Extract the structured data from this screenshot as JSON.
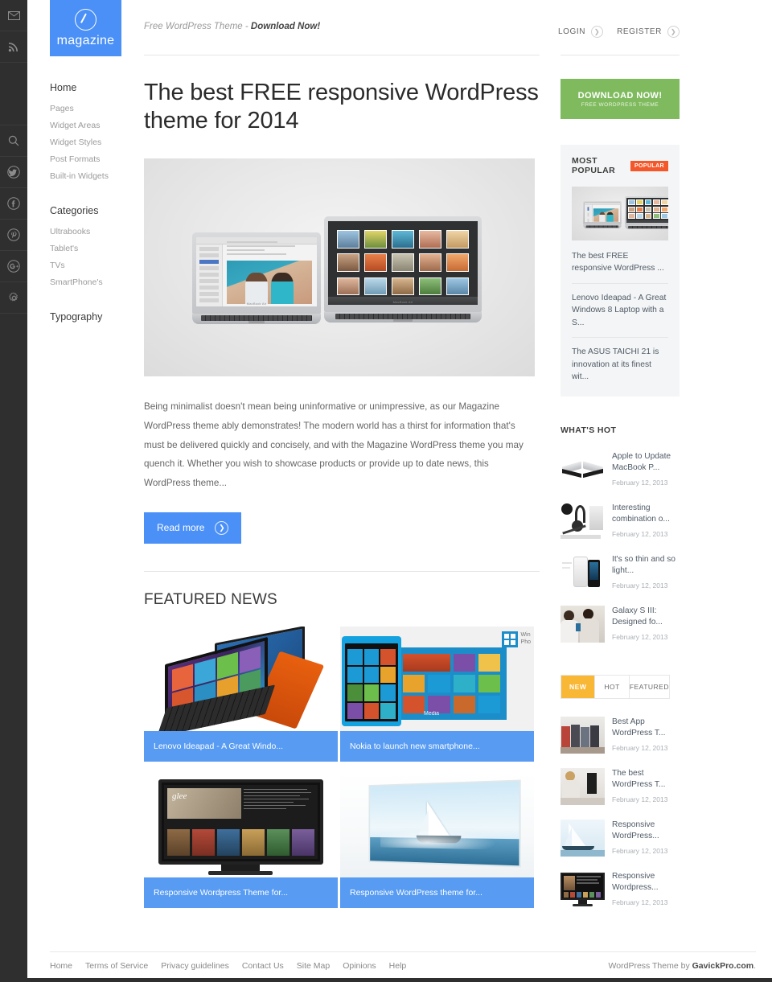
{
  "rail": {
    "icons": [
      {
        "name": "mail-icon",
        "label": "Mail"
      },
      {
        "name": "rss-icon",
        "label": "RSS"
      },
      {
        "name": "search-icon",
        "label": "Search"
      },
      {
        "name": "twitter-icon",
        "label": "Twitter"
      },
      {
        "name": "facebook-icon",
        "label": "Facebook"
      },
      {
        "name": "pinterest-icon",
        "label": "Pinterest"
      },
      {
        "name": "google-plus-icon",
        "label": "Google Plus"
      },
      {
        "name": "gear-icon",
        "label": "Settings"
      }
    ]
  },
  "logo": {
    "text": "magazine",
    "mark": "pencil-in-circle-icon"
  },
  "header": {
    "tagline_prefix": "Free WordPress Theme - ",
    "tagline_link": "Download Now!",
    "login_label": "LOGIN",
    "register_label": "REGISTER"
  },
  "nav": {
    "primary_head": "Home",
    "primary_items": [
      "Pages",
      "Widget Areas",
      "Widget Styles",
      "Post Formats",
      "Built-in Widgets"
    ],
    "categories_head": "Categories",
    "categories_items": [
      "Ultrabooks",
      "Tablet's",
      "TVs",
      "SmartPhone's"
    ],
    "typography_head": "Typography"
  },
  "post": {
    "title": "The best FREE responsive WordPress theme for 2014",
    "excerpt": "Being minimalist doesn't mean being uninformative or unimpressive, as our Magazine WordPress theme ably demonstrates! The modern world has a thirst for information that's must be delivered quickly and concisely, and with the Magazine WordPress theme you may quench it. Whether you wish to showcase products or provide up to date news, this WordPress theme...",
    "read_more": "Read more",
    "hero_alt": "Two MacBook Air laptops on grey background"
  },
  "featured": {
    "title": "FEATURED NEWS",
    "cards": [
      {
        "caption": "Lenovo Ideapad - A Great Windo...",
        "art": "lenovo-yoga"
      },
      {
        "caption": "Nokia to launch new smartphone...",
        "art": "nokia-windows-phone"
      },
      {
        "caption": "Responsive Wordpress Theme for...",
        "art": "tv-glee"
      },
      {
        "caption": "Responsive WordPress theme for...",
        "art": "sailboat-tv"
      }
    ]
  },
  "sidebar": {
    "download": {
      "line1": "DOWNLOAD NOW!",
      "line2": "FREE WORDPRESS THEME"
    },
    "most_popular": {
      "title": "MOST POPULAR",
      "badge": "POPULAR",
      "items": [
        "The best FREE responsive WordPress ...",
        "Lenovo Ideapad - A Great Windows 8 Laptop with a S...",
        "The ASUS TAICHI 21 is innovation at its finest wit..."
      ]
    },
    "whats_hot": {
      "title": "WHAT'S HOT",
      "items": [
        {
          "title": "Apple to Update MacBook P...",
          "date": "February 12, 2013",
          "art": "macbook-pair"
        },
        {
          "title": "Interesting combination o...",
          "date": "February 12, 2013",
          "art": "headphones"
        },
        {
          "title": "It's so thin and so light...",
          "date": "February 12, 2013",
          "art": "iphone"
        },
        {
          "title": "Galaxy S III: Designed fo...",
          "date": "February 12, 2013",
          "art": "two-girls"
        }
      ]
    },
    "tabs": [
      {
        "label": "NEW",
        "active": true
      },
      {
        "label": "HOT",
        "active": false
      },
      {
        "label": "FEATURED",
        "active": false
      }
    ],
    "new_items": [
      {
        "title": "Best App WordPress T...",
        "date": "February 12, 2013",
        "art": "people-sitting"
      },
      {
        "title": "The best WordPress T...",
        "date": "February 12, 2013",
        "art": "woman-desk"
      },
      {
        "title": "Responsive WordPress...",
        "date": "February 12, 2013",
        "art": "sailboat"
      },
      {
        "title": "Responsive Wordpress...",
        "date": "February 12, 2013",
        "art": "tv-screen"
      }
    ]
  },
  "footer": {
    "links": [
      "Home",
      "Terms of Service",
      "Privacy guidelines",
      "Contact Us",
      "Site Map",
      "Opinions",
      "Help"
    ],
    "copy_prefix": "WordPress Theme by ",
    "copy_brand": "GavickPro.com",
    "copy_suffix": "."
  },
  "colors": {
    "accent_blue": "#4a90f7",
    "caption_blue": "#579bf2",
    "green": "#7fbb5e",
    "orange_badge": "#f4582a",
    "tab_yellow": "#f8b735",
    "rail_dark": "#2f2f2f"
  }
}
